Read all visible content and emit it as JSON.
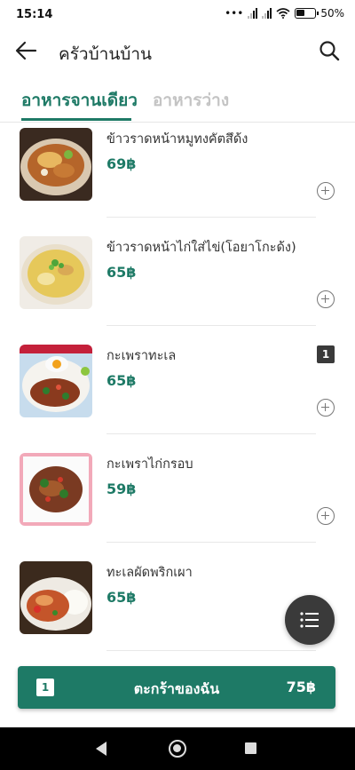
{
  "status_bar": {
    "time": "15:14",
    "dots": "•••",
    "battery": "50%"
  },
  "app_bar": {
    "title": "ครัวบ้านบ้าน",
    "back_icon": "arrow-left-icon",
    "search_icon": "search-icon"
  },
  "tabs": [
    {
      "label": "อาหารจานเดียว",
      "active": true
    },
    {
      "label": "อาหารว่าง",
      "active": false
    }
  ],
  "menu_items": [
    {
      "name": "ข้าวราดหน้าหมูทงคัตสึด้ง",
      "price": "69฿",
      "image": "katsudon-photo",
      "quantity": ""
    },
    {
      "name": "ข้าวราดหน้าไก่ใส่ไข่(โอยาโกะด้ง)",
      "price": "65฿",
      "image": "oyakodon-photo",
      "quantity": ""
    },
    {
      "name": "กะเพราทะเล",
      "price": "65฿",
      "image": "seafood-kaprao-photo",
      "quantity": "1"
    },
    {
      "name": "กะเพราไก่กรอบ",
      "price": "59฿",
      "image": "crispy-chicken-kaprao-photo",
      "quantity": ""
    },
    {
      "name": "ทะเลผัดพริกเผา",
      "price": "65฿",
      "image": "seafood-chili-paste-photo",
      "quantity": ""
    }
  ],
  "fab": {
    "icon": "list-menu-icon"
  },
  "cart": {
    "count": "1",
    "label": "ตะกร้าของฉัน",
    "total": "75฿"
  },
  "nav": {
    "back_icon": "nav-back-icon",
    "home_icon": "nav-home-icon",
    "recent_icon": "nav-recent-icon"
  },
  "colors": {
    "accent": "#1e7a66",
    "fab": "#3a3a3a",
    "inactive_tab": "#c4c4c4"
  }
}
